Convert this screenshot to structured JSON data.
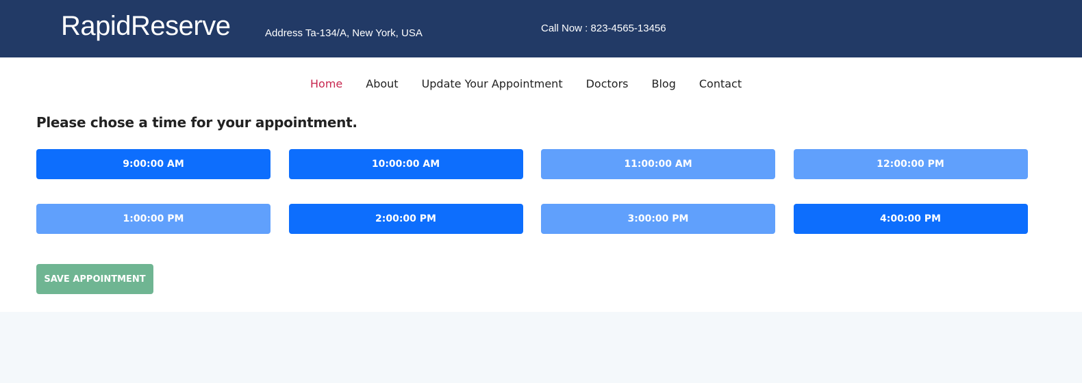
{
  "header": {
    "brand": "RapidReserve",
    "address": "Address Ta-134/A, New York, USA",
    "phone": "Call Now : 823-4565-13456"
  },
  "nav": [
    "Home",
    "About",
    "Update Your Appointment",
    "Doctors",
    "Blog",
    "Contact"
  ],
  "heading": "Please chose a time for your appointment.",
  "slots": [
    {
      "label": "9:00:00 AM",
      "available": true
    },
    {
      "label": "10:00:00 AM",
      "available": true
    },
    {
      "label": "11:00:00 AM",
      "available": false
    },
    {
      "label": "12:00:00 PM",
      "available": false
    },
    {
      "label": "1:00:00 PM",
      "available": false
    },
    {
      "label": "2:00:00 PM",
      "available": true
    },
    {
      "label": "3:00:00 PM",
      "available": false
    },
    {
      "label": "4:00:00 PM",
      "available": true
    }
  ],
  "save_label": "SAVE APPOINTMENT",
  "colors": {
    "header": "#223a66",
    "available": "#0d6efd",
    "unavailable": "#60a0fc",
    "save": "#6fb592",
    "active_nav": "#c7254e"
  }
}
